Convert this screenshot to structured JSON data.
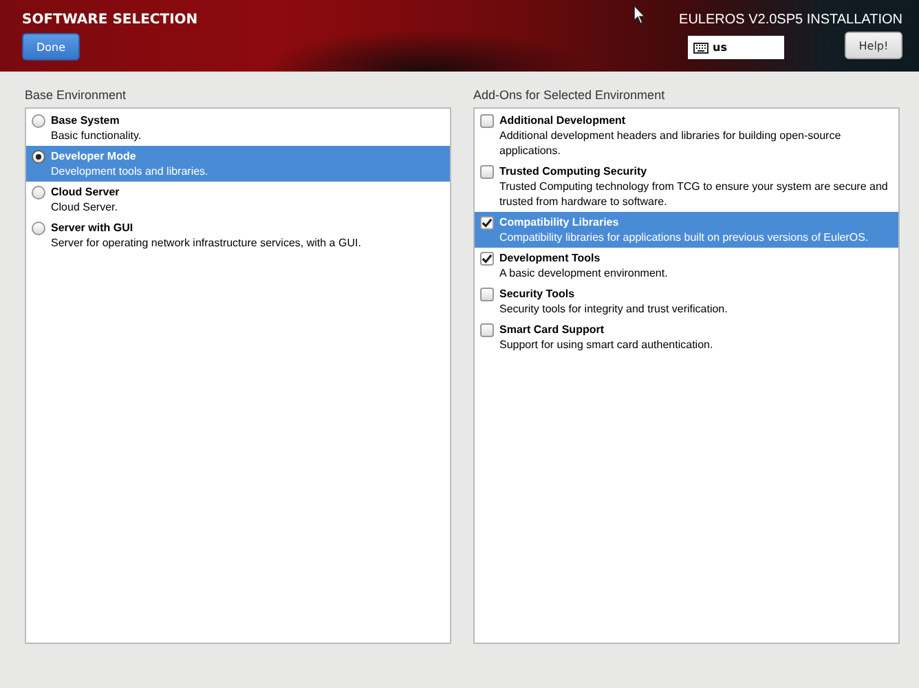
{
  "header": {
    "title": "SOFTWARE SELECTION",
    "done_button": "Done",
    "product": "EULEROS V2.0SP5 INSTALLATION",
    "keyboard_layout": "us",
    "help_button": "Help!"
  },
  "base_environment": {
    "heading": "Base Environment",
    "items": [
      {
        "name": "Base System",
        "description": "Basic functionality.",
        "selected": false
      },
      {
        "name": "Developer Mode",
        "description": "Development tools and libraries.",
        "selected": true
      },
      {
        "name": "Cloud Server",
        "description": "Cloud Server.",
        "selected": false
      },
      {
        "name": "Server with GUI",
        "description": "Server for operating network infrastructure services, with a GUI.",
        "selected": false
      }
    ]
  },
  "addons": {
    "heading": "Add-Ons for Selected Environment",
    "items": [
      {
        "name": "Additional Development",
        "description": "Additional development headers and libraries for building open-source applications.",
        "checked": false,
        "selected": false
      },
      {
        "name": "Trusted Computing Security",
        "description": "Trusted Computing technology from TCG to ensure your system are secure and trusted from hardware to software.",
        "checked": false,
        "selected": false
      },
      {
        "name": "Compatibility Libraries",
        "description": "Compatibility libraries for applications built on previous versions of EulerOS.",
        "checked": true,
        "selected": true
      },
      {
        "name": "Development Tools",
        "description": "A basic development environment.",
        "checked": true,
        "selected": false
      },
      {
        "name": "Security Tools",
        "description": "Security tools for integrity and trust verification.",
        "checked": false,
        "selected": false
      },
      {
        "name": "Smart Card Support",
        "description": "Support for using smart card authentication.",
        "checked": false,
        "selected": false
      }
    ]
  }
}
